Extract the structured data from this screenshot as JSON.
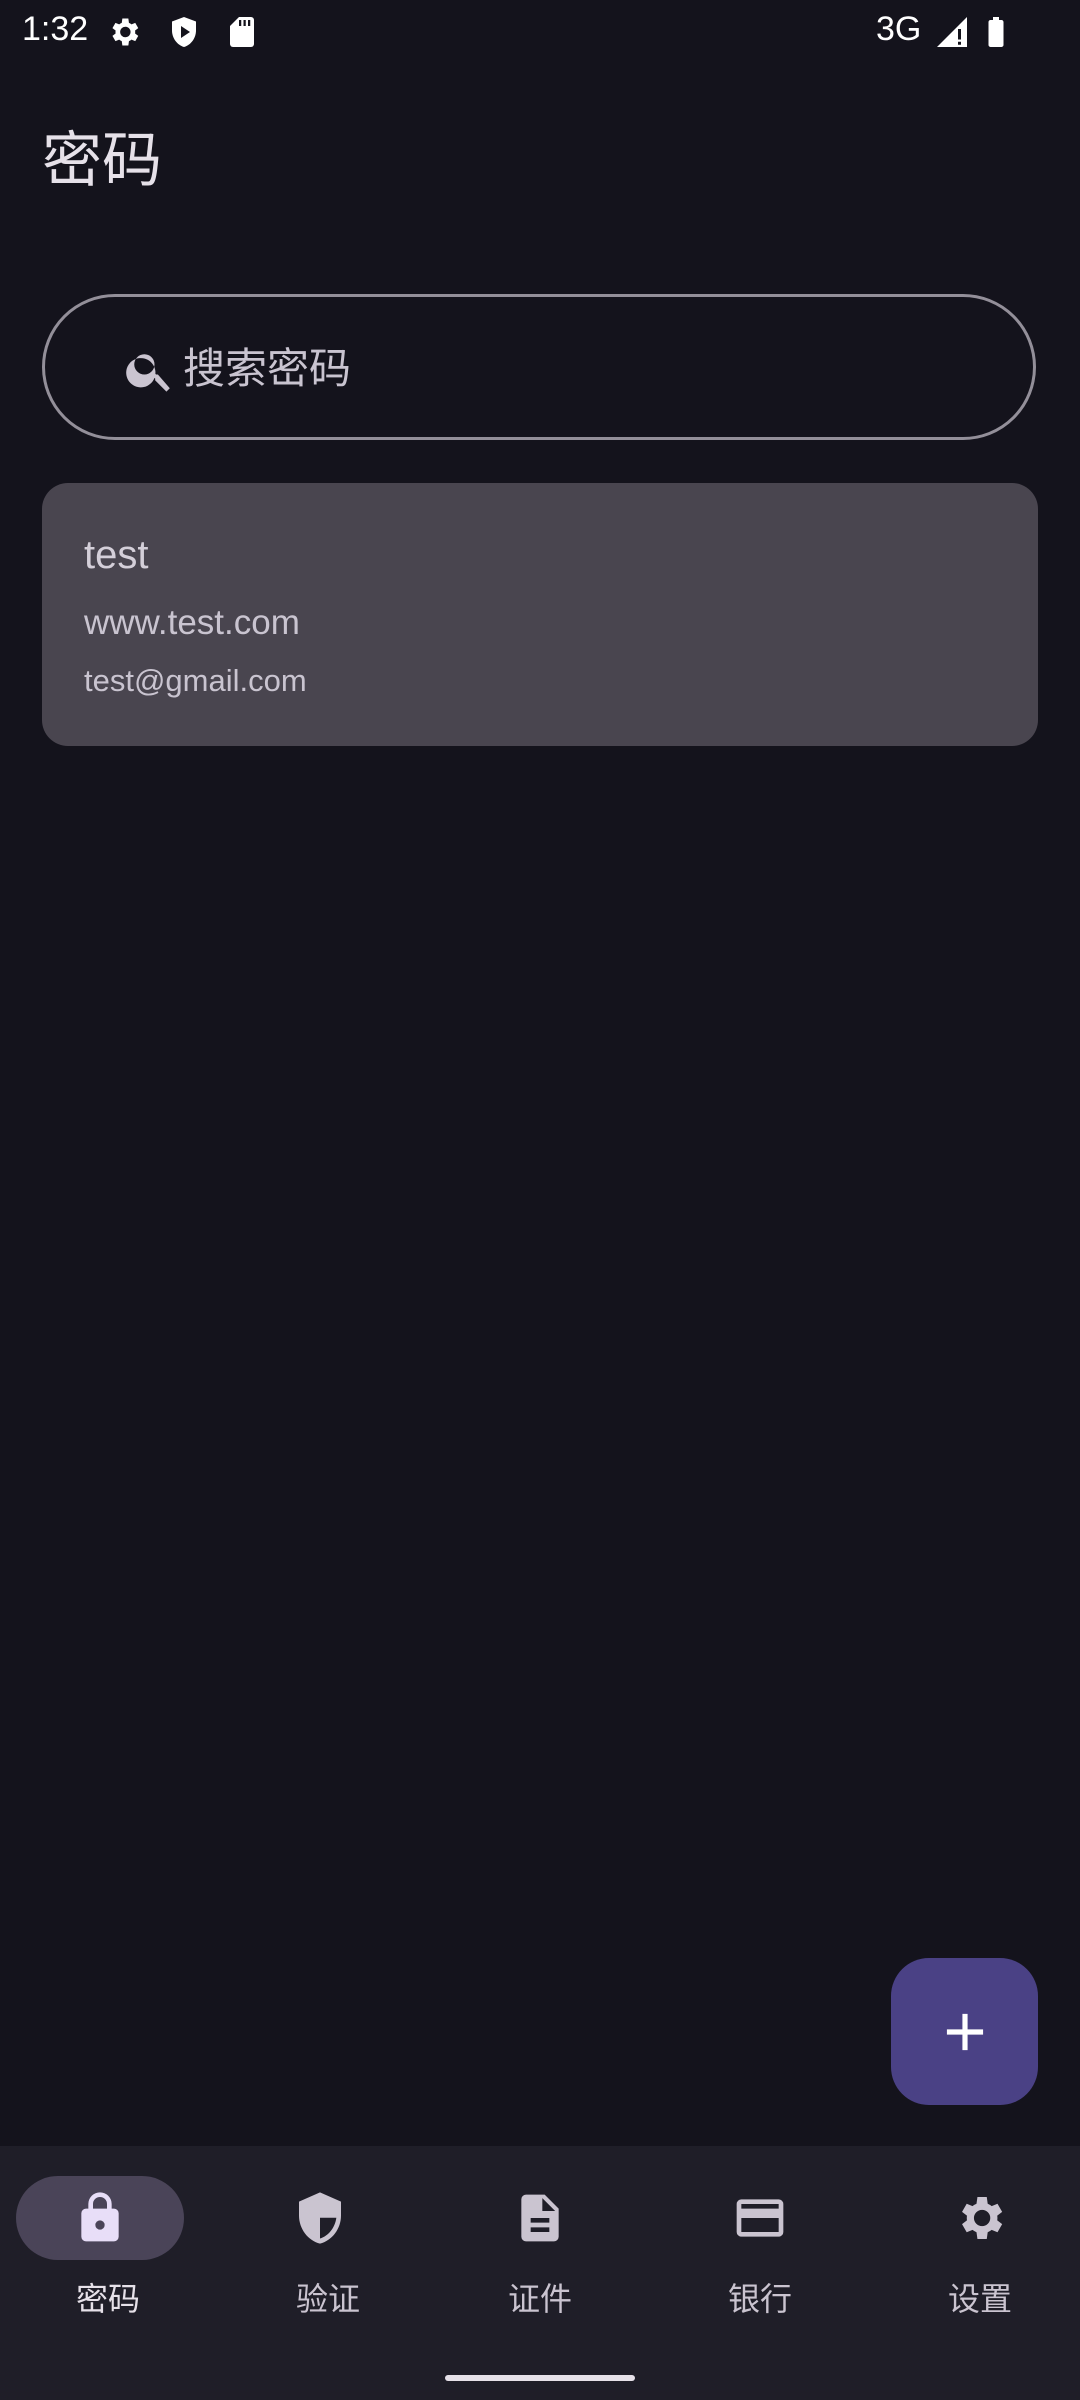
{
  "status_bar": {
    "time": "1:32",
    "network": "3G",
    "icons": [
      "gear-icon",
      "shield-play-icon",
      "sd-card-icon",
      "signal-icon",
      "battery-icon"
    ]
  },
  "header": {
    "title": "密码"
  },
  "search": {
    "placeholder": "搜索密码",
    "value": ""
  },
  "entries": [
    {
      "title": "test",
      "url": "www.test.com",
      "email": "test@gmail.com"
    }
  ],
  "fab": {
    "icon": "plus-icon"
  },
  "bottom_nav": {
    "items": [
      {
        "label": "密码",
        "icon": "lock-icon",
        "active": true
      },
      {
        "label": "验证",
        "icon": "shield-icon",
        "active": false
      },
      {
        "label": "证件",
        "icon": "document-icon",
        "active": false
      },
      {
        "label": "银行",
        "icon": "credit-card-icon",
        "active": false
      },
      {
        "label": "设置",
        "icon": "gear-icon",
        "active": false
      }
    ]
  },
  "colors": {
    "background": "#14131c",
    "card": "#49454f",
    "fab": "#4a4185",
    "nav_background": "#1f1e28",
    "nav_active_pill": "#4a4458"
  }
}
